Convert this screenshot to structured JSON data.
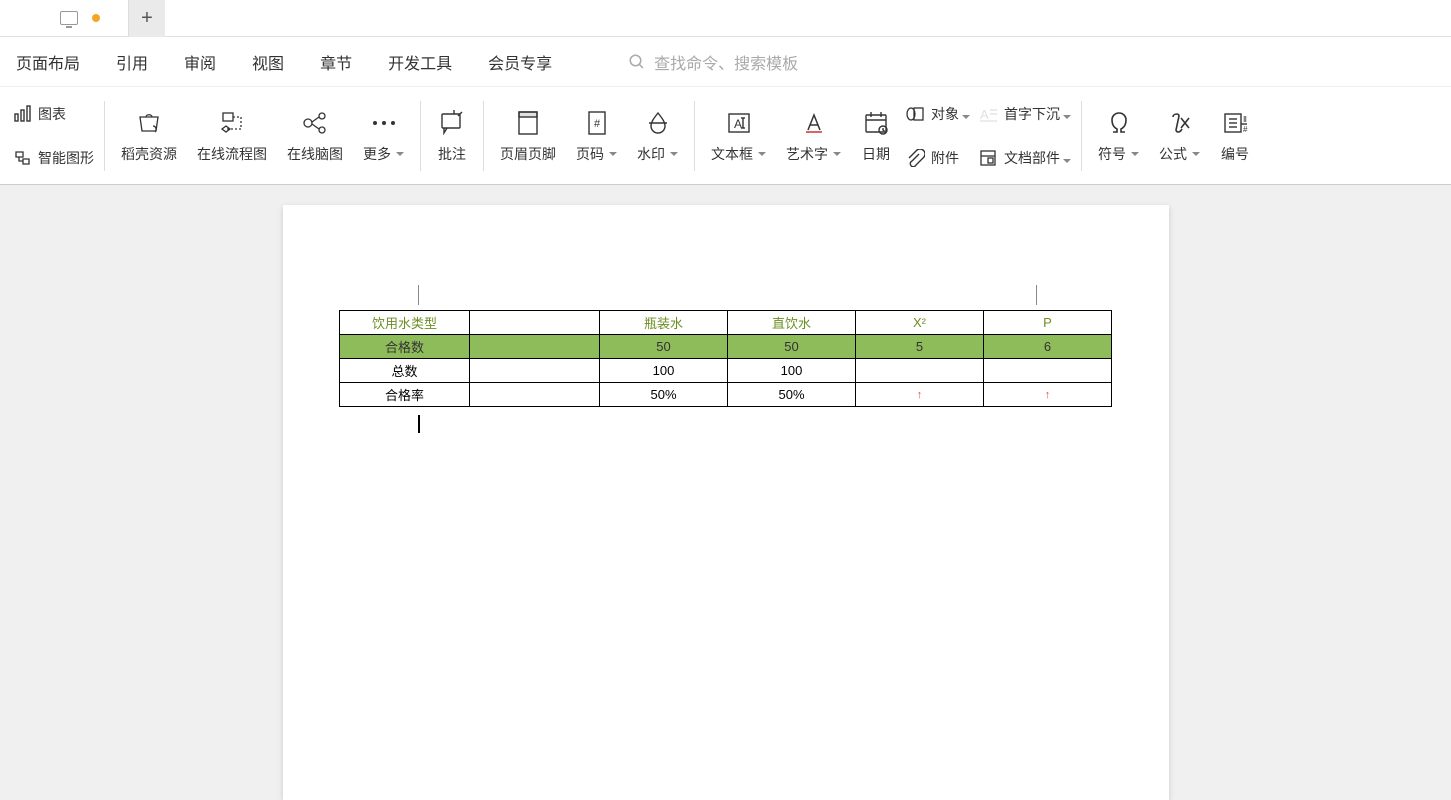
{
  "menu": [
    "页面布局",
    "引用",
    "审阅",
    "视图",
    "章节",
    "开发工具",
    "会员专享"
  ],
  "search_placeholder": "查找命令、搜索模板",
  "ribbon": {
    "chart": "图表",
    "smartshape": "智能图形",
    "dkres": "稻壳资源",
    "flowchart": "在线流程图",
    "mindmap": "在线脑图",
    "more": "更多",
    "comment": "批注",
    "headerfooter": "页眉页脚",
    "pageno": "页码",
    "watermark": "水印",
    "textbox": "文本框",
    "wordart": "艺术字",
    "date": "日期",
    "object": "对象",
    "attach": "附件",
    "dropcap": "首字下沉",
    "docparts": "文档部件",
    "symbol": "符号",
    "formula": "公式",
    "numbering": "编号"
  },
  "table": {
    "header": [
      "饮用水类型",
      "",
      "瓶装水",
      "直饮水",
      "X²",
      "P"
    ],
    "rows": [
      [
        "合格数",
        "",
        "50",
        "50",
        "5",
        "6"
      ],
      [
        "总数",
        "",
        "100",
        "100",
        "",
        ""
      ],
      [
        "合格率",
        "",
        "50%",
        "50%",
        "↑",
        "↑"
      ]
    ]
  }
}
